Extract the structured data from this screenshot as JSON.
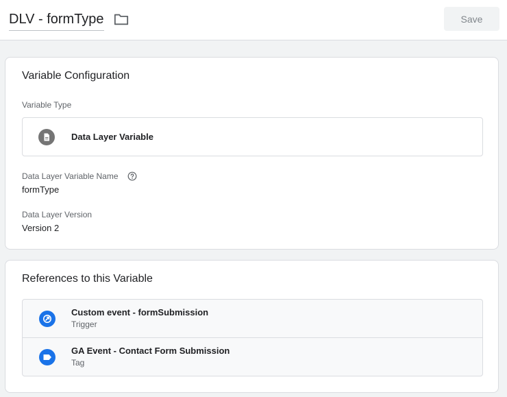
{
  "header": {
    "title": "DLV - formType",
    "folder_icon": "folder-icon",
    "save_label": "Save"
  },
  "config": {
    "title": "Variable Configuration",
    "variable_type_label": "Variable Type",
    "variable_type": "Data Layer Variable",
    "variable_type_icon": "document-icon",
    "dlv_name_label": "Data Layer Variable Name",
    "help_icon": "help-icon",
    "dlv_name_value": "formType",
    "version_label": "Data Layer Version",
    "version_value": "Version 2"
  },
  "references": {
    "title": "References to this Variable",
    "items": [
      {
        "name": "Custom event - formSubmission",
        "type": "Trigger",
        "icon": "trigger-icon"
      },
      {
        "name": "GA Event - Contact Form Submission",
        "type": "Tag",
        "icon": "tag-icon"
      }
    ]
  },
  "colors": {
    "accent": "#1a73e8",
    "icon_gray": "#757575",
    "background": "#f1f3f4"
  }
}
